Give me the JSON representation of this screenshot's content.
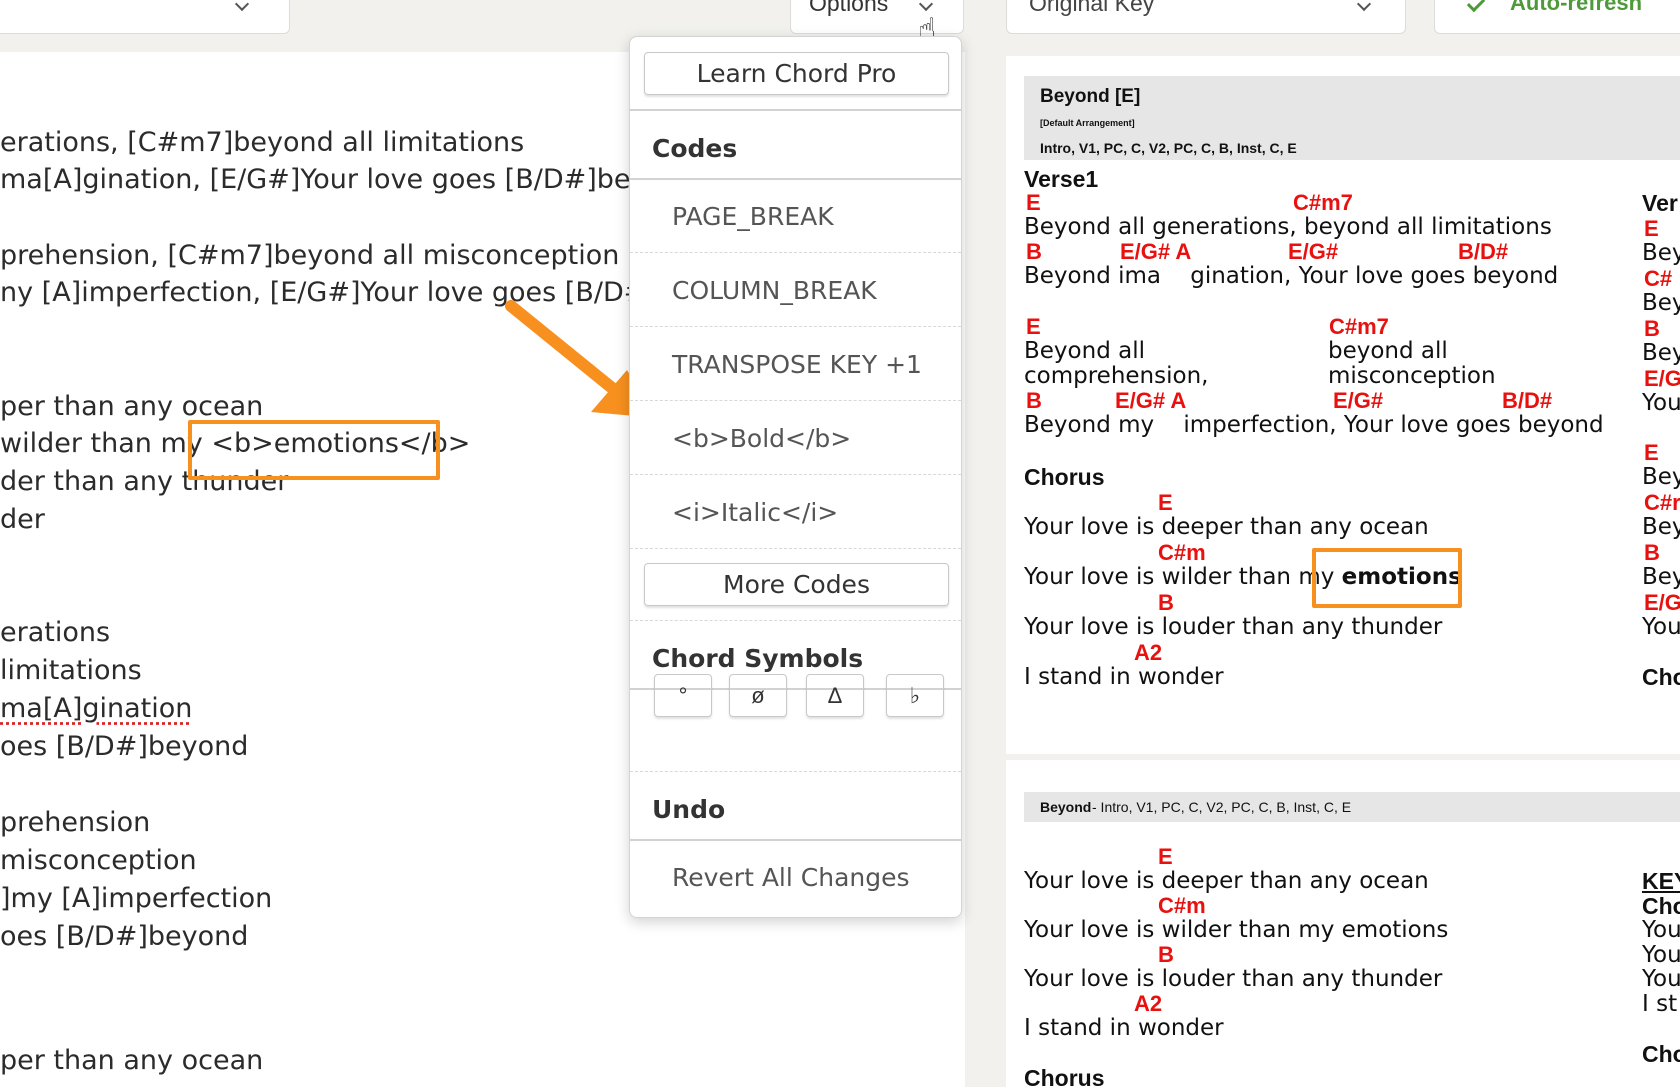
{
  "toolbar": {
    "options_label": "Options",
    "key_select_value": "Original Key",
    "refresh_label": "Auto-refresh"
  },
  "editor": {
    "lines": [
      "erations, [C#m7]beyond all limitations",
      "ma[A]gination, [E/G#]Your love goes [B/D#]beyo",
      "prehension, [C#m7]beyond all misconception",
      "ny [A]imperfection, [E/G#]Your love goes [B/D#]l",
      "per than any ocean",
      "wilder than my <b>emotions</b>",
      "der than any thunder",
      "der",
      "erations",
      "limitations",
      "ma[A]gination",
      "oes [B/D#]beyond",
      "prehension",
      "misconception",
      "]my [A]imperfection",
      "oes [B/D#]beyond",
      "per than any ocean"
    ]
  },
  "menu": {
    "learn": "Learn Chord Pro",
    "codes_heading": "Codes",
    "codes": [
      "PAGE_BREAK",
      "COLUMN_BREAK",
      "TRANSPOSE KEY +1",
      "<b>Bold</b>",
      "<i>Italic</i>"
    ],
    "more_codes": "More Codes",
    "chord_symbols_heading": "Chord Symbols",
    "symbols": [
      "°",
      "ø",
      "Δ",
      "♭"
    ],
    "undo_heading": "Undo",
    "revert": "Revert All Changes"
  },
  "preview": {
    "title": "Beyond [E]",
    "arrangement": "[Default Arrangement]",
    "order": "Intro, V1, PC, C, V2, PC, C, B, Inst, C, E",
    "verse_label": "Verse1",
    "chorus_label": "Chorus",
    "v_chords_1": [
      "E",
      "C#m7"
    ],
    "v_lyric_1": "Beyond all generations, beyond all limitations",
    "v_chords_2": [
      "B",
      "E/G# A",
      "E/G#",
      "B/D#"
    ],
    "v_lyric_2": "Beyond ima    gination, Your love goes beyond",
    "v_chords_3": [
      "E",
      "C#m7"
    ],
    "v_lyric_3a": "Beyond all",
    "v_lyric_3b": "comprehension,",
    "v_lyric_3c": "beyond all",
    "v_lyric_3d": "misconception",
    "v_chords_4": [
      "B",
      "E/G# A",
      "E/G#",
      "B/D#"
    ],
    "v_lyric_4": "Beyond my    imperfection, Your love goes beyond",
    "c_chords": [
      "E",
      "C#m",
      "B",
      "A2"
    ],
    "c_lyrics": [
      "Your love is deeper than any ocean",
      "Your love is wilder than my ",
      "Your love is louder than any thunder",
      "I stand in wonder"
    ],
    "c_bold": "emotions",
    "side_col": [
      "Ver",
      "E",
      "Bey",
      "C#",
      "Bey",
      "B",
      "Bey",
      "E/G",
      "You",
      "E",
      "Bey",
      "C#r",
      "Bey",
      "B",
      "Bey",
      "E/G",
      "You",
      "Cho"
    ],
    "page2_title": "Beyond",
    "page2_order": " - Intro, V1, PC, C, V2, PC, C, B, Inst, C, E",
    "p2_chords": [
      "E",
      "C#m",
      "B",
      "A2"
    ],
    "p2_lyrics": [
      "Your love is deeper than any ocean",
      "Your love is wilder than my emotions",
      "Your love is louder than any thunder",
      "I stand in wonder"
    ],
    "p2_chorus": "Chorus",
    "p2_side": [
      "KEY",
      "Cho",
      "You",
      "You",
      "You",
      "I st",
      "Cho"
    ]
  },
  "colors": {
    "accent": "#f7901e",
    "chord": "#e8110f",
    "refresh": "#4e9a3b"
  }
}
